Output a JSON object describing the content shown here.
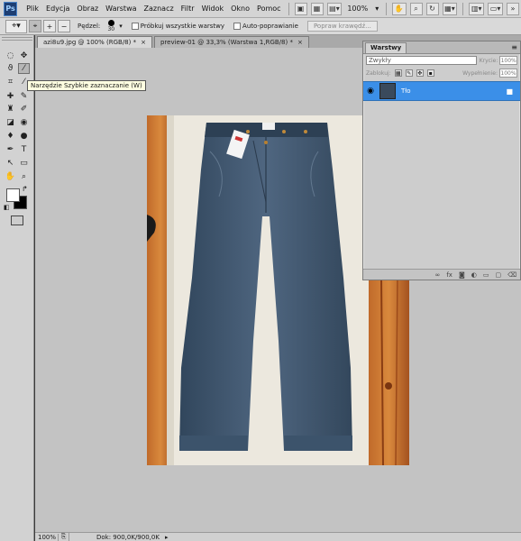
{
  "app": {
    "logo": "Ps",
    "menu": [
      "Plik",
      "Edycja",
      "Obraz",
      "Warstwa",
      "Zaznacz",
      "Filtr",
      "Widok",
      "Okno",
      "Pomoc"
    ],
    "zoom": "100%"
  },
  "options_bar": {
    "brush_label": "Pędzel:",
    "brush_size": "30",
    "sample_all_label": "Próbkuj wszystkie warstwy",
    "auto_enhance_label": "Auto-poprawianie",
    "refine_edge_label": "Popraw krawędź..."
  },
  "tooltip": "Narzędzie Szybkie zaznaczanie (W)",
  "tabs": [
    {
      "label": "azi8u9.jpg @ 100% (RGB/8) *",
      "close": "×",
      "active": true
    },
    {
      "label": "preview-01 @ 33,3% (Warstwa 1,RGB/8) *",
      "close": "×",
      "active": false
    }
  ],
  "status": {
    "zoom": "100%",
    "doc": "Dok: 900,0K/900,0K"
  },
  "layers_panel": {
    "title": "Warstwy",
    "blend_mode": "Zwykły",
    "opacity_label": "Krycie:",
    "opacity": "100%",
    "lock_label": "Zablokuj:",
    "fill_label": "Wypełnienie:",
    "fill": "100%",
    "layer_name": "Tło"
  },
  "colors": {
    "accent": "#3b8fe8",
    "canvas_bg": "#c3c3c3",
    "foreground": "#ffffff",
    "background": "#000000"
  }
}
